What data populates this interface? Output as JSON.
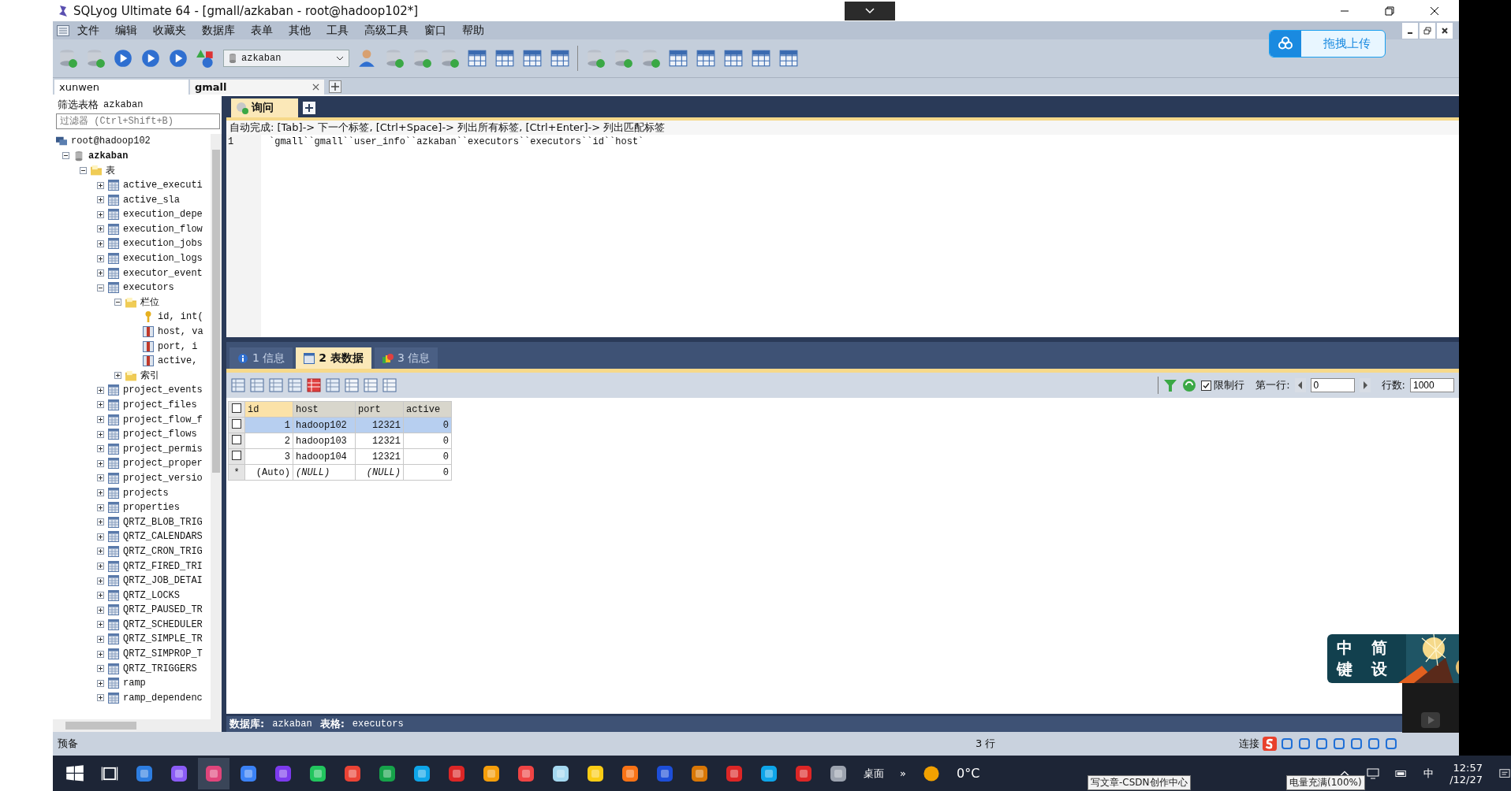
{
  "window": {
    "title": "SQLyog Ultimate 64 - [gmall/azkaban - root@hadoop102*]"
  },
  "menu": [
    "文件",
    "编辑",
    "收藏夹",
    "数据库",
    "表单",
    "其他",
    "工具",
    "高级工具",
    "窗口",
    "帮助"
  ],
  "toolbar": {
    "database": "azkaban",
    "upload_button": "拖拽上传"
  },
  "connection_tabs": [
    {
      "label": "xunwen",
      "selected": false
    },
    {
      "label": "gmall",
      "selected": true
    }
  ],
  "sidebar": {
    "filter_label": "筛选表格",
    "filter_db": "azkaban",
    "filter_placeholder": "过滤器 (Ctrl+Shift+B)",
    "tree": [
      {
        "label": "root@hadoop102",
        "kind": "server",
        "children": [
          {
            "label": "azkaban",
            "kind": "database",
            "expanded": true,
            "children": [
              {
                "label": "表",
                "kind": "folder",
                "expanded": true,
                "children": [
                  {
                    "label": "active_executi",
                    "kind": "table",
                    "expanded": false
                  },
                  {
                    "label": "active_sla",
                    "kind": "table",
                    "expanded": false
                  },
                  {
                    "label": "execution_depe",
                    "kind": "table",
                    "expanded": false
                  },
                  {
                    "label": "execution_flow",
                    "kind": "table",
                    "expanded": false
                  },
                  {
                    "label": "execution_jobs",
                    "kind": "table",
                    "expanded": false
                  },
                  {
                    "label": "execution_logs",
                    "kind": "table",
                    "expanded": false
                  },
                  {
                    "label": "executor_event",
                    "kind": "table",
                    "expanded": false
                  },
                  {
                    "label": "executors",
                    "kind": "table",
                    "expanded": true,
                    "children": [
                      {
                        "label": "栏位",
                        "kind": "folder",
                        "expanded": true,
                        "children": [
                          {
                            "label": "id, int(",
                            "kind": "key"
                          },
                          {
                            "label": "host, va",
                            "kind": "column"
                          },
                          {
                            "label": "port, i",
                            "kind": "column"
                          },
                          {
                            "label": "active,",
                            "kind": "column"
                          }
                        ]
                      },
                      {
                        "label": "索引",
                        "kind": "folder",
                        "expanded": false
                      }
                    ]
                  },
                  {
                    "label": "project_events",
                    "kind": "table",
                    "expanded": false
                  },
                  {
                    "label": "project_files",
                    "kind": "table",
                    "expanded": false
                  },
                  {
                    "label": "project_flow_f",
                    "kind": "table",
                    "expanded": false
                  },
                  {
                    "label": "project_flows",
                    "kind": "table",
                    "expanded": false
                  },
                  {
                    "label": "project_permis",
                    "kind": "table",
                    "expanded": false
                  },
                  {
                    "label": "project_proper",
                    "kind": "table",
                    "expanded": false
                  },
                  {
                    "label": "project_versio",
                    "kind": "table",
                    "expanded": false
                  },
                  {
                    "label": "projects",
                    "kind": "table",
                    "expanded": false
                  },
                  {
                    "label": "properties",
                    "kind": "table",
                    "expanded": false
                  },
                  {
                    "label": "QRTZ_BLOB_TRIG",
                    "kind": "table",
                    "expanded": false
                  },
                  {
                    "label": "QRTZ_CALENDARS",
                    "kind": "table",
                    "expanded": false
                  },
                  {
                    "label": "QRTZ_CRON_TRIG",
                    "kind": "table",
                    "expanded": false
                  },
                  {
                    "label": "QRTZ_FIRED_TRI",
                    "kind": "table",
                    "expanded": false
                  },
                  {
                    "label": "QRTZ_JOB_DETAI",
                    "kind": "table",
                    "expanded": false
                  },
                  {
                    "label": "QRTZ_LOCKS",
                    "kind": "table",
                    "expanded": false
                  },
                  {
                    "label": "QRTZ_PAUSED_TR",
                    "kind": "table",
                    "expanded": false
                  },
                  {
                    "label": "QRTZ_SCHEDULER",
                    "kind": "table",
                    "expanded": false
                  },
                  {
                    "label": "QRTZ_SIMPLE_TR",
                    "kind": "table",
                    "expanded": false
                  },
                  {
                    "label": "QRTZ_SIMPROP_T",
                    "kind": "table",
                    "expanded": false
                  },
                  {
                    "label": "QRTZ_TRIGGERS",
                    "kind": "table",
                    "expanded": false
                  },
                  {
                    "label": "ramp",
                    "kind": "table",
                    "expanded": false
                  },
                  {
                    "label": "ramp_dependenc",
                    "kind": "table",
                    "expanded": false
                  }
                ]
              }
            ]
          }
        ]
      }
    ]
  },
  "query_tabs": [
    {
      "label": "询问",
      "selected": true
    }
  ],
  "editor": {
    "hint": "自动完成: [Tab]-> 下一个标签, [Ctrl+Space]-> 列出所有标签, [Ctrl+Enter]-> 列出匹配标签",
    "lines": [
      {
        "number": "1",
        "code": "`gmall``gmall``user_info``azkaban``executors``executors``id``host`"
      }
    ]
  },
  "result_tabs": [
    {
      "label": "1 信息",
      "kind": "info",
      "selected": false
    },
    {
      "label": "2 表数据",
      "kind": "table",
      "selected": true
    },
    {
      "label": "3 信息",
      "kind": "profile",
      "selected": false
    }
  ],
  "results": {
    "limit": {
      "label": "限制行",
      "checked": true
    },
    "first_row": {
      "label": "第一行:",
      "value": "0"
    },
    "row_count": {
      "label": "行数:",
      "value": "1000"
    },
    "grid": {
      "select_all": false,
      "columns": [
        "id",
        "host",
        "port",
        "active"
      ],
      "rows": [
        {
          "kind": "data",
          "selected": true,
          "checked": false,
          "cells": [
            "1",
            "hadoop102",
            "12321",
            "0"
          ]
        },
        {
          "kind": "data",
          "selected": false,
          "checked": false,
          "cells": [
            "2",
            "hadoop103",
            "12321",
            "0"
          ]
        },
        {
          "kind": "data",
          "selected": false,
          "checked": false,
          "cells": [
            "3",
            "hadoop104",
            "12321",
            "0"
          ]
        },
        {
          "kind": "new",
          "selected": false,
          "marker": "*",
          "cells": [
            "(Auto)",
            {
              "text": "(NULL)",
              "null": true
            },
            {
              "text": "(NULL)",
              "null": true
            },
            "0"
          ]
        }
      ]
    },
    "footer": {
      "db_label": "数据库:",
      "db": "azkaban",
      "table_label": "表格:",
      "table": "executors"
    }
  },
  "status_bar": {
    "state": "预备",
    "rows": "3 行",
    "connection": "连接"
  },
  "ime_widget": {
    "chars": [
      "中",
      "简",
      "键",
      "设"
    ]
  },
  "taskbar": {
    "desktop": "桌面",
    "more": "»",
    "weather": "0°C",
    "ime": "中",
    "time": "12:57",
    "date": "/12/27",
    "tooltips": [
      "写文章-CSDN创作中心",
      "电量充满(100%)"
    ]
  }
}
